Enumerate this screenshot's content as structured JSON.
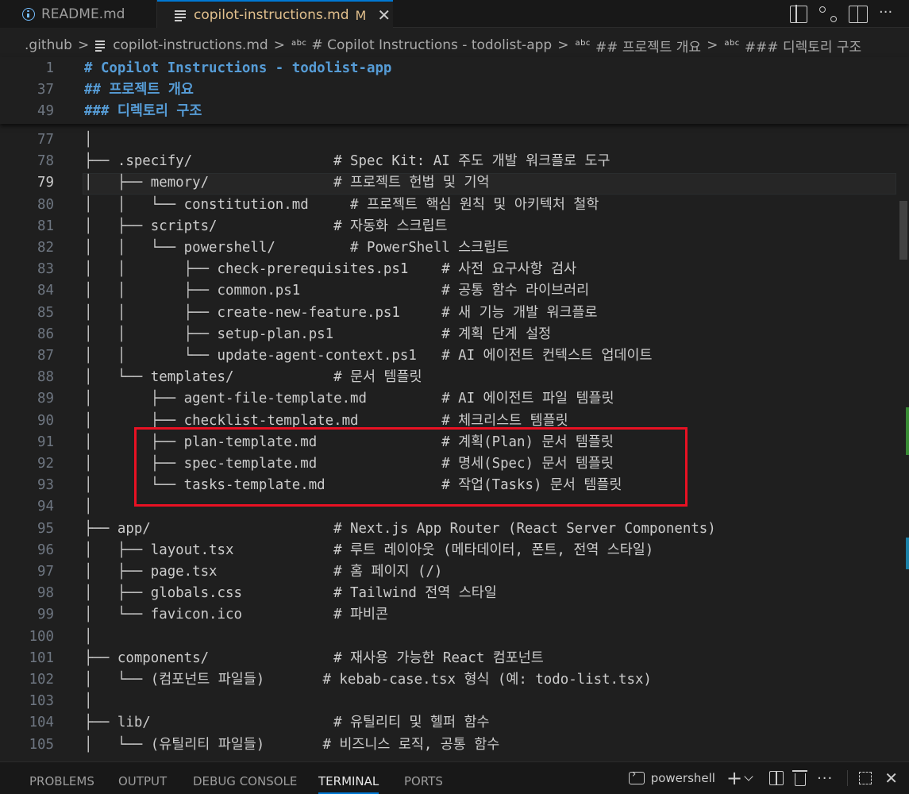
{
  "tabs": [
    {
      "label": "README.md",
      "icon": "info-icon"
    },
    {
      "label": "copilot-instructions.md",
      "modified": "M",
      "icon": "markdown-lines-icon"
    }
  ],
  "breadcrumb": {
    "folder": ".github",
    "file": "copilot-instructions.md",
    "symbols": [
      "# Copilot Instructions - todolist-app",
      "## 프로젝트 개요",
      "### 디렉토리 구조"
    ],
    "symbol_tag": "abc"
  },
  "sticky_lines": [
    {
      "num": "1",
      "text": "# Copilot Instructions - todolist-app"
    },
    {
      "num": "37",
      "text": "## 프로젝트 개요"
    },
    {
      "num": "49",
      "text": "### 디렉토리 구조"
    }
  ],
  "current_line": "79",
  "code_lines": [
    {
      "num": "77",
      "text": "│"
    },
    {
      "num": "78",
      "text": "├── .specify/                 # Spec Kit: AI 주도 개발 워크플로 도구"
    },
    {
      "num": "79",
      "text": "│   ├── memory/               # 프로젝트 헌법 및 기억"
    },
    {
      "num": "80",
      "text": "│   │   └── constitution.md     # 프로젝트 핵심 원칙 및 아키텍처 철학"
    },
    {
      "num": "81",
      "text": "│   ├── scripts/              # 자동화 스크립트"
    },
    {
      "num": "82",
      "text": "│   │   └── powershell/         # PowerShell 스크립트"
    },
    {
      "num": "83",
      "text": "│   │       ├── check-prerequisites.ps1    # 사전 요구사항 검사"
    },
    {
      "num": "84",
      "text": "│   │       ├── common.ps1                 # 공통 함수 라이브러리"
    },
    {
      "num": "85",
      "text": "│   │       ├── create-new-feature.ps1     # 새 기능 개발 워크플로"
    },
    {
      "num": "86",
      "text": "│   │       ├── setup-plan.ps1             # 계획 단계 설정"
    },
    {
      "num": "87",
      "text": "│   │       └── update-agent-context.ps1   # AI 에이전트 컨텍스트 업데이트"
    },
    {
      "num": "88",
      "text": "│   └── templates/            # 문서 템플릿"
    },
    {
      "num": "89",
      "text": "│       ├── agent-file-template.md         # AI 에이전트 파일 템플릿"
    },
    {
      "num": "90",
      "text": "│       ├── checklist-template.md          # 체크리스트 템플릿"
    },
    {
      "num": "91",
      "text": "│       ├── plan-template.md               # 계획(Plan) 문서 템플릿"
    },
    {
      "num": "92",
      "text": "│       ├── spec-template.md               # 명세(Spec) 문서 템플릿"
    },
    {
      "num": "93",
      "text": "│       └── tasks-template.md              # 작업(Tasks) 문서 템플릿"
    },
    {
      "num": "94",
      "text": "│"
    },
    {
      "num": "95",
      "text": "├── app/                      # Next.js App Router (React Server Components)"
    },
    {
      "num": "96",
      "text": "│   ├── layout.tsx            # 루트 레이아웃 (메타데이터, 폰트, 전역 스타일)"
    },
    {
      "num": "97",
      "text": "│   ├── page.tsx              # 홈 페이지 (/)"
    },
    {
      "num": "98",
      "text": "│   ├── globals.css           # Tailwind 전역 스타일"
    },
    {
      "num": "99",
      "text": "│   └── favicon.ico           # 파비콘"
    },
    {
      "num": "100",
      "text": "│"
    },
    {
      "num": "101",
      "text": "├── components/               # 재사용 가능한 React 컴포넌트"
    },
    {
      "num": "102",
      "text": "│   └── (컴포넌트 파일들)       # kebab-case.tsx 형식 (예: todo-list.tsx)"
    },
    {
      "num": "103",
      "text": "│"
    },
    {
      "num": "104",
      "text": "├── lib/                      # 유틸리티 및 헬퍼 함수"
    },
    {
      "num": "105",
      "text": "│   └── (유틸리티 파일들)       # 비즈니스 로직, 공통 함수"
    }
  ],
  "panel": {
    "tabs": [
      "PROBLEMS",
      "OUTPUT",
      "DEBUG CONSOLE",
      "TERMINAL",
      "PORTS"
    ],
    "active": "TERMINAL",
    "terminal_name": "powershell"
  },
  "colors": {
    "accent": "#0078d4",
    "modified": "#e2c08d",
    "heading": "#569cd6",
    "highlight": "#e81123",
    "git_added": "#388a34",
    "git_modified": "#1b81a8"
  }
}
